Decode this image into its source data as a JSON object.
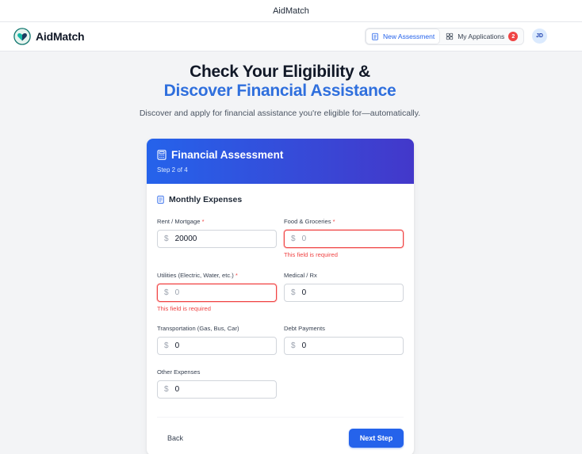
{
  "window": {
    "title": "AidMatch"
  },
  "nav": {
    "brand": "AidMatch",
    "new_assessment": "New Assessment",
    "my_applications": "My Applications",
    "applications_count": "2",
    "avatar_initials": "JD"
  },
  "hero": {
    "line1": "Check Your Eligibility &",
    "line2": "Discover Financial Assistance",
    "subtitle": "Discover and apply for financial assistance you're eligible for—automatically."
  },
  "card": {
    "title": "Financial Assessment",
    "step": "Step 2 of 4",
    "section_title": "Monthly Expenses",
    "currency_symbol": "$",
    "required_mark": "*",
    "fields": {
      "rent": {
        "label": "Rent / Mortgage",
        "value": "20000"
      },
      "food": {
        "label": "Food & Groceries",
        "placeholder": "0",
        "error": "This field is required"
      },
      "utilities": {
        "label": "Utilities (Electric, Water, etc.)",
        "placeholder": "0",
        "error": "This field is required"
      },
      "medical": {
        "label": "Medical / Rx",
        "value": "0"
      },
      "transportation": {
        "label": "Transportation (Gas, Bus, Car)",
        "value": "0"
      },
      "debt": {
        "label": "Debt Payments",
        "value": "0"
      },
      "other": {
        "label": "Other Expenses",
        "value": "0"
      }
    },
    "back_label": "Back",
    "next_label": "Next Step"
  },
  "colors": {
    "primary": "#2563eb",
    "header_gradient_end": "#4338ca",
    "error": "#ef4444",
    "accent_text": "#2f6fdd"
  },
  "icons": {
    "brand": "heart-shield-logo",
    "new_assessment": "clipboard-icon",
    "my_applications": "grid-icon",
    "card_title": "calculator-icon",
    "section": "receipt-icon"
  }
}
